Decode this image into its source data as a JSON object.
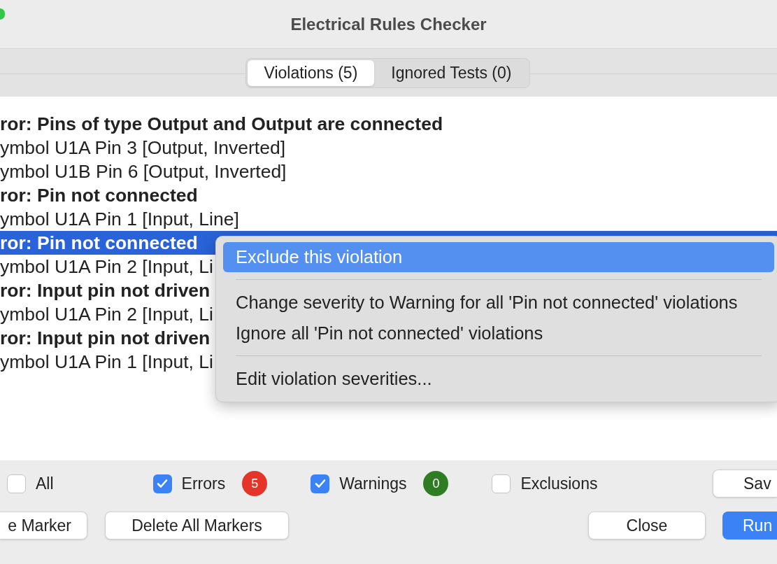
{
  "window": {
    "title": "Electrical Rules Checker"
  },
  "tabs": [
    {
      "label": "Violations (5)",
      "selected": true
    },
    {
      "label": "Ignored Tests (0)",
      "selected": false
    }
  ],
  "violations": [
    {
      "kind": "error",
      "text": "ror: Pins of type Output and Output are connected",
      "selected": false
    },
    {
      "kind": "item",
      "text": "ymbol U1A Pin 3 [Output, Inverted]",
      "selected": false
    },
    {
      "kind": "item",
      "text": "ymbol U1B Pin 6 [Output, Inverted]",
      "selected": false
    },
    {
      "kind": "error",
      "text": "ror: Pin not connected",
      "selected": false
    },
    {
      "kind": "item",
      "text": "ymbol U1A Pin 1 [Input, Line]",
      "selected": false
    },
    {
      "kind": "error",
      "text": "ror: Pin not connected",
      "selected": true
    },
    {
      "kind": "item",
      "text": "ymbol U1A Pin 2 [Input, Li",
      "selected": false
    },
    {
      "kind": "error",
      "text": "ror: Input pin not driven",
      "selected": false
    },
    {
      "kind": "item",
      "text": "ymbol U1A Pin 2 [Input, Li",
      "selected": false
    },
    {
      "kind": "error",
      "text": "ror: Input pin not driven",
      "selected": false
    },
    {
      "kind": "item",
      "text": "ymbol U1A Pin 1 [Input, Li",
      "selected": false
    }
  ],
  "context_menu": [
    {
      "kind": "item",
      "label": "Exclude this violation",
      "selected": true
    },
    {
      "kind": "separator"
    },
    {
      "kind": "item",
      "label": "Change severity to Warning for all 'Pin not connected' violations",
      "selected": false
    },
    {
      "kind": "item",
      "label": "Ignore all 'Pin not connected' violations",
      "selected": false
    },
    {
      "kind": "separator"
    },
    {
      "kind": "item",
      "label": "Edit violation severities...",
      "selected": false
    }
  ],
  "filters": [
    {
      "label": "All",
      "checked": false
    },
    {
      "label": "Errors",
      "checked": true,
      "count": "5",
      "color": "#e5352b"
    },
    {
      "label": "Warnings",
      "checked": true,
      "count": "0",
      "color": "#2f7d22"
    },
    {
      "label": "Exclusions",
      "checked": false
    }
  ],
  "save_button": "Sav",
  "buttons": [
    {
      "label": "e Marker",
      "kind": "plain"
    },
    {
      "label": "Delete All Markers",
      "kind": "plain"
    },
    {
      "label": "Close",
      "kind": "plain"
    },
    {
      "label": "Run",
      "kind": "primary"
    }
  ]
}
